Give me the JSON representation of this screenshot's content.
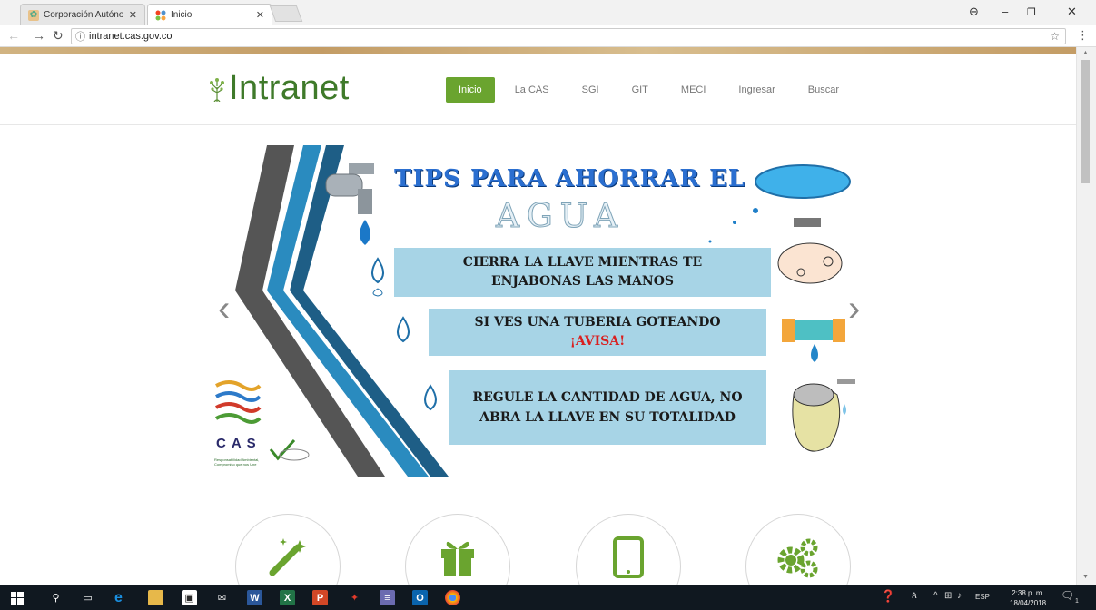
{
  "browser": {
    "tabs": [
      {
        "title": "Corporación Autónoma I",
        "favicon": "cas-favicon"
      },
      {
        "title": "Inicio",
        "favicon": "joomla-favicon"
      }
    ],
    "url": "intranet.cas.gov.co",
    "icons": [
      "back-icon",
      "forward-icon",
      "reload-icon",
      "info-icon",
      "star-icon",
      "menu-icon"
    ]
  },
  "site": {
    "logo_text": "Intranet",
    "brand_color": "#3f7a2a",
    "accent_color": "#6aa42f",
    "menu": [
      {
        "label": "Inicio",
        "active": true
      },
      {
        "label": "La CAS"
      },
      {
        "label": "SGI"
      },
      {
        "label": "GIT"
      },
      {
        "label": "MECI"
      },
      {
        "label": "Ingresar"
      },
      {
        "label": "Buscar"
      }
    ]
  },
  "slide": {
    "title_line1": "TIPS PARA AHORRAR EL",
    "title_line2": "AGUA",
    "tip1": "CIERRA LA LLAVE MIENTRAS TE ENJABONAS LAS MANOS",
    "tip2_line1": "SI VES UNA TUBERIA GOTEANDO",
    "tip2_line2": "¡AVISA!",
    "tip3": "REGULE LA CANTIDAD DE AGUA, NO ABRA LA LLAVE EN SU TOTALIDAD",
    "org_logo": "CAS",
    "org_tagline": "Responsabilidad Ambiental, Compromiso que nos Une",
    "sgi_badge": "SGI",
    "prev_label": "‹",
    "next_label": "›"
  },
  "features": [
    {
      "icon": "magic-wand-icon",
      "color": "#6aa42f"
    },
    {
      "icon": "gift-icon",
      "color": "#6aa42f"
    },
    {
      "icon": "tablet-icon",
      "color": "#6aa42f"
    },
    {
      "icon": "gears-icon",
      "color": "#6aa42f"
    }
  ],
  "taskbar": {
    "language": "ESP",
    "time": "2:38 p. m.",
    "date": "18/04/2018",
    "notifications": "1"
  }
}
